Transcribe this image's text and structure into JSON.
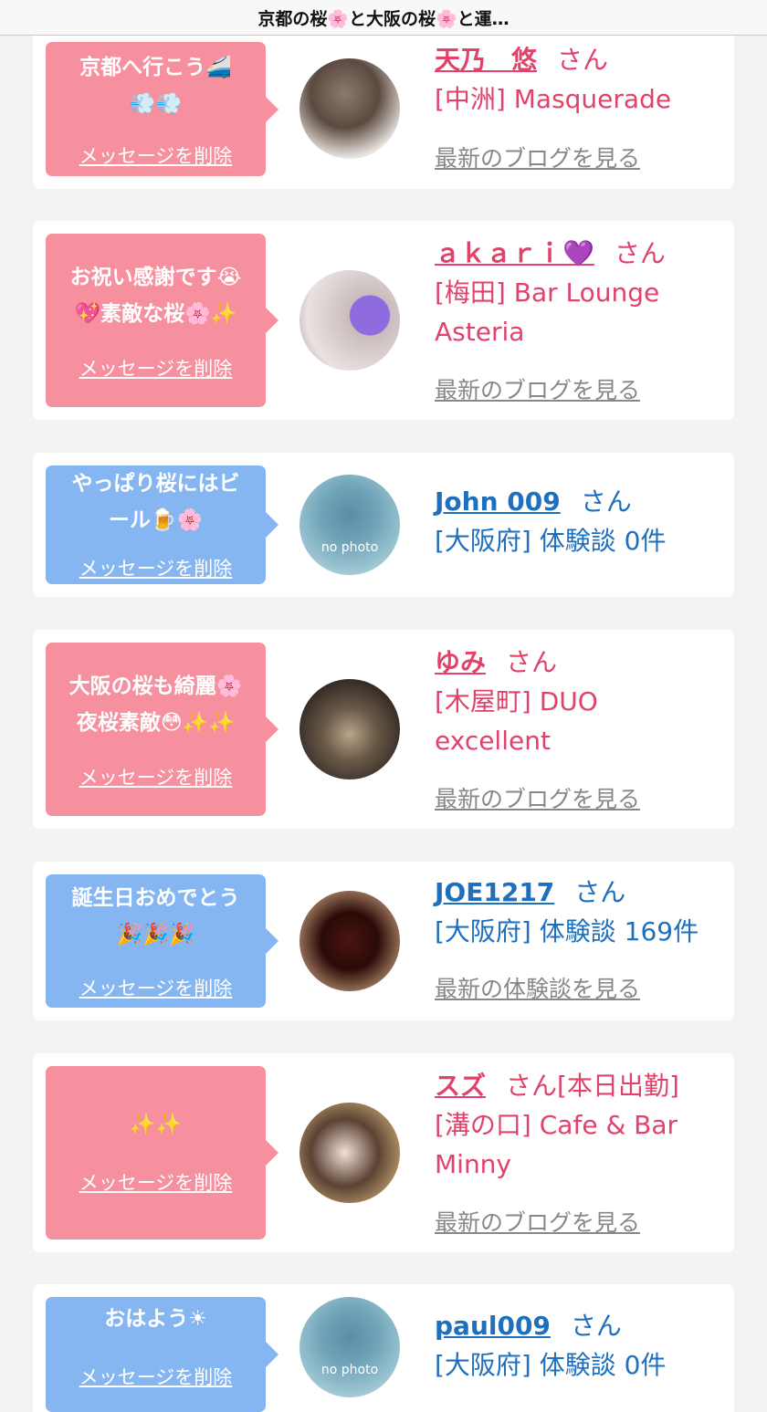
{
  "header": {
    "title": "京都の桜🌸と大阪の桜🌸と運…"
  },
  "common": {
    "delete_label": "メッセージを削除",
    "honorific": "さん"
  },
  "cards": [
    {
      "message_lines": [
        "京都へ行こう🚄",
        "💨💨"
      ],
      "name": "天乃　悠",
      "shop": "[中洲] Masquerade",
      "link": "最新のブログを見る"
    },
    {
      "message_lines": [
        "お祝い感謝です😭",
        "💖素敵な桜🌸✨"
      ],
      "name": "ａｋａｒｉ💜",
      "shop_lines": [
        "[梅田] Bar Lounge",
        "Asteria"
      ],
      "link": "最新のブログを見る"
    },
    {
      "message_lines": [
        "やっぱり桜にはビ",
        "ール🍺🌸"
      ],
      "name": "John 009",
      "info": "[大阪府] 体験談 0件",
      "no_photo": "no photo"
    },
    {
      "message_lines": [
        "大阪の桜も綺麗🌸",
        "夜桜素敵😳✨✨"
      ],
      "name": "ゆみ",
      "shop_lines": [
        "[木屋町] DUO",
        "excellent"
      ],
      "link": "最新のブログを見る"
    },
    {
      "message_lines": [
        "誕生日おめでとう",
        "🎉🎉🎉"
      ],
      "name": "JOE1217",
      "info": "[大阪府] 体験談 169件",
      "link": "最新の体験談を見る"
    },
    {
      "message_lines": [
        "✨✨"
      ],
      "name": "スズ",
      "honorific_status": "さん[本日出勤]",
      "shop_lines": [
        "[溝の口] Cafe & Bar",
        "Minny"
      ],
      "link": "最新のブログを見る"
    },
    {
      "message_lines": [
        "おはよう☀"
      ],
      "name": "paul009",
      "info": "[大阪府] 体験談 0件",
      "no_photo": "no photo"
    }
  ],
  "colors": {
    "pink_bubble": "#f6909f",
    "blue_bubble": "#86b6f1",
    "pink_text": "#e1426a",
    "blue_text": "#1e6fbd",
    "background": "#f3f3f3"
  }
}
